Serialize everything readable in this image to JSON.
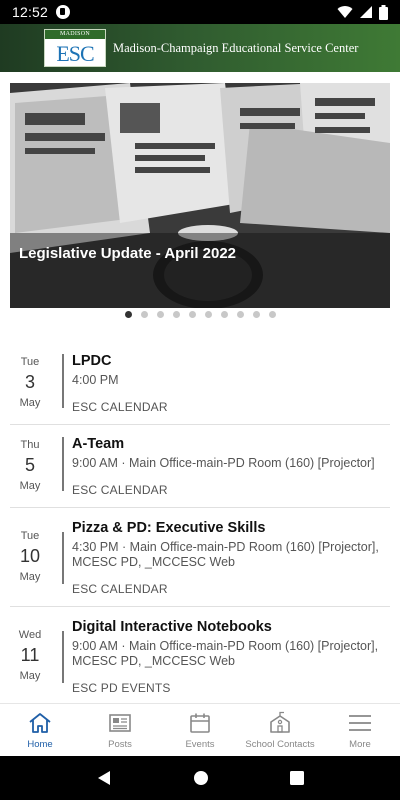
{
  "status_bar": {
    "time": "12:52"
  },
  "header": {
    "logo_top_text": "MADISON CHAMPAIGN",
    "logo_letters": "ESC",
    "title": "Madison-Champaign Educational Service Center"
  },
  "carousel": {
    "caption": "Legislative Update - April 2022",
    "slide_count": 10,
    "active_index": 0
  },
  "events": [
    {
      "dow": "Tue",
      "day": "3",
      "month": "May",
      "title": "LPDC",
      "meta": "4:00 PM",
      "calendar": "ESC CALENDAR"
    },
    {
      "dow": "Thu",
      "day": "5",
      "month": "May",
      "title": "A-Team",
      "meta": "9:00 AM · Main Office-main-PD Room (160) [Projector]",
      "calendar": "ESC CALENDAR"
    },
    {
      "dow": "Tue",
      "day": "10",
      "month": "May",
      "title": "Pizza & PD: Executive Skills",
      "meta": "4:30 PM · Main Office-main-PD Room (160) [Projector], MCESC PD, _MCCESC Web",
      "calendar": "ESC CALENDAR"
    },
    {
      "dow": "Wed",
      "day": "11",
      "month": "May",
      "title": "Digital Interactive Notebooks",
      "meta": "9:00 AM · Main Office-main-PD Room (160) [Projector], MCESC PD, _MCCESC Web",
      "calendar": "ESC PD EVENTS"
    }
  ],
  "bottom_nav": [
    {
      "label": "Home",
      "icon": "home-icon",
      "active": true
    },
    {
      "label": "Posts",
      "icon": "newspaper-icon",
      "active": false
    },
    {
      "label": "Events",
      "icon": "calendar-icon",
      "active": false
    },
    {
      "label": "School Contacts",
      "icon": "school-icon",
      "active": false
    },
    {
      "label": "More",
      "icon": "menu-icon",
      "active": false
    }
  ],
  "colors": {
    "header_dark": "#1f3b22",
    "header_light": "#3f7a35",
    "nav_active": "#1f5fa8",
    "nav_inactive": "#888888"
  }
}
